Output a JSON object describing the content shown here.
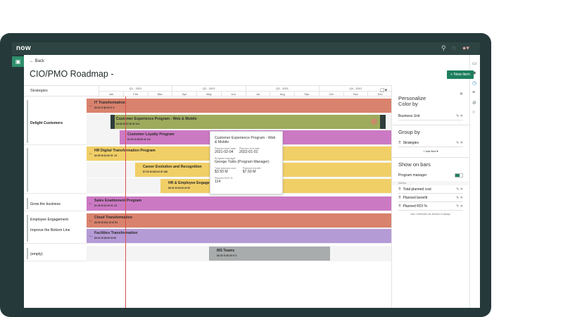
{
  "app": {
    "logo": "now",
    "back": "← Back",
    "title": "CIO/PMO Roadmap -",
    "new_item": "+ New item"
  },
  "icons": {
    "search": "⚲",
    "bell": "🔔",
    "avatar": "●"
  },
  "timeline": {
    "strategies_label": "Strategies",
    "quarters": [
      "Q1 - 2021",
      "Q2 - 2021",
      "Q3 - 2021",
      "Q4 - 2021"
    ],
    "months": [
      "Jan",
      "Feb",
      "Mar",
      "Apr",
      "May",
      "Jun",
      "Jul",
      "Aug",
      "Sep",
      "Oct",
      "Nov",
      "Dec"
    ],
    "today_month_fraction": 1.08
  },
  "groups": [
    {
      "label": "Delight Customers"
    },
    {
      "label": "Employee Engagement"
    },
    {
      "label": "Grow the business"
    },
    {
      "label": "Improve the Bottom Line"
    },
    {
      "label": "(empty)"
    }
  ],
  "bars": [
    {
      "name": "IT Transformation",
      "metrics": "$0.00 K   $0.00 K   0",
      "color": "#d9826d"
    },
    {
      "name": "Customer Experience Program - Web & Mobile",
      "metrics": "$3.50 M   $7.50 M   114",
      "color": "#9eaa5c"
    },
    {
      "name": "Customer Loyalty Program",
      "metrics": "$4.00 M   $8.50 M   113",
      "color": "#cc79c4"
    },
    {
      "name": "HR Digital Transformation Program",
      "metrics": "$2.99 M   $2.62 M   -13",
      "color": "#f1cf67"
    },
    {
      "name": "Career Evolution and Recognition",
      "metrics": "$7.00 M   $20.00 M   186",
      "color": "#f1cf67"
    },
    {
      "name": "HR & Employee Engagement",
      "metrics": "$6.00 M   $9.00 M   50",
      "color": "#f1cf67"
    },
    {
      "name": "Sales Enablement Program",
      "metrics": "$1.28 M   $1.00 M   -22",
      "color": "#cc79c4"
    },
    {
      "name": "Cloud Transformation",
      "metrics": "$6.50 M   $10.10 M   54",
      "color": "#d9826d"
    },
    {
      "name": "Facilities Transformation",
      "metrics": "$5.00 M   $8.00 M   60",
      "color": "#b59bd6"
    },
    {
      "name": "MS Teams",
      "metrics": "$0.00 K   $0.00 K   0",
      "color": "#a9acac"
    }
  ],
  "tooltip": {
    "title": "Customer Experience Program - Web & Mobile",
    "start_label": "Planned start date",
    "start": "2021-02-04",
    "end_label": "Planned end date",
    "end": "2022-01-01",
    "pm_label": "Program manager",
    "pm": "George Tukis (Program Manager)",
    "cost_label": "Total planned cost",
    "cost": "$3.50 M",
    "benefit_label": "Planned benefit",
    "benefit": "$7.50 M",
    "roi_label": "Planned ROI %",
    "roi": "114"
  },
  "panel": {
    "title": "Personalize",
    "color_by": "Color by",
    "color_field": "Business Unit",
    "group_by": "Group by",
    "group_field": "Strategies",
    "add_field": "+ Add field ▾",
    "show_on_bars": "Show on bars",
    "program_manager": "Program manager",
    "program_manager_on": true,
    "metrics_label": "Metrics",
    "metrics": [
      "Total planned cost",
      "Planned benefit",
      "Planned ROI %"
    ],
    "note": "Max 3 attributes are allowed to display."
  }
}
